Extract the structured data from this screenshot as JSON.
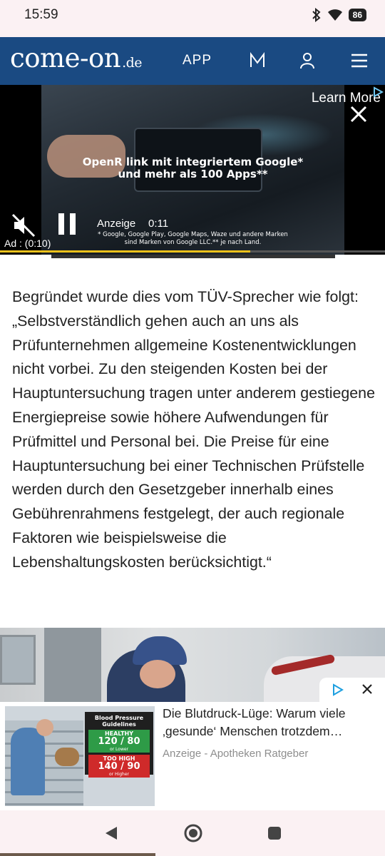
{
  "status_bar": {
    "time": "15:59",
    "battery": "86"
  },
  "header": {
    "logo": "come-on",
    "logo_tld": ".de",
    "app_link": "APP"
  },
  "video_ad": {
    "learn_more": "Learn More",
    "caption_line1": "OpenR link mit integriertem Google*",
    "caption_line2": "und mehr als 100 Apps**",
    "disclaimer_line1": "* Google, Google Play, Google Maps, Waze und andere Marken",
    "disclaimer_line2": "sind Marken von Google LLC.** je nach Land.",
    "ad_label": "Anzeige",
    "ad_time": "0:11",
    "ad_counter": "Ad : (0:10)",
    "progress": 0.65
  },
  "article": {
    "paragraph": "Begründet wurde dies vom TÜV-Sprecher wie folgt: „Selbstverständlich gehen auch an uns als Prüfunternehmen allgemeine Kostenentwicklungen nicht vorbei. Zu den steigenden Kosten bei der Hauptuntersuchung tragen unter anderem gestiegene Energiepreise sowie höhere Aufwendungen für Prüfmittel und Personal bei. Die Preise für eine Hauptuntersuchung bei einer Technischen Prüfstelle werden durch den Gesetzgeber innerhalb eines Gebührenrahmens festgelegt, der auch regionale Faktoren wie beispielsweise die Lebenshaltungskosten berücksichtigt.“"
  },
  "sponsored": {
    "title": "Die Blutdruck-Lüge: Warum viele ‚gesunde‘ Menschen trotzdem…",
    "source": "Anzeige - Apotheken Ratgeber",
    "chart_title": "Blood Pressure Guidelines",
    "healthy_label": "HEALTHY",
    "healthy_value": "120 / 80",
    "healthy_note": "or Lower",
    "high_label": "TOO HIGH",
    "high_value": "140 / 90",
    "high_note": "or Higher"
  },
  "nav": {
    "back": "back",
    "home": "home",
    "recents": "recents"
  }
}
